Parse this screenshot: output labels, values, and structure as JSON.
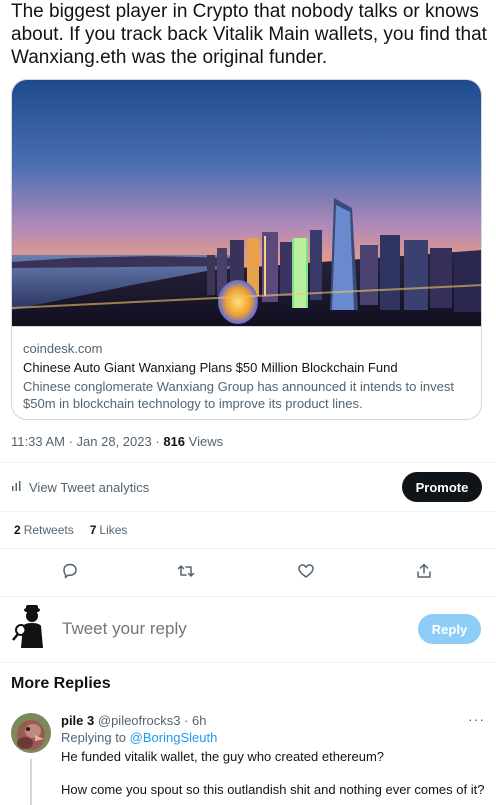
{
  "tweet": {
    "text": "The biggest player in Crypto that nobody talks or knows about. If you track back Vitalik Main wallets, you find that Wanxiang.eth was the original funder."
  },
  "card": {
    "domain": "coindesk.com",
    "title": "Chinese Auto Giant Wanxiang Plans $50 Million Blockchain Fund",
    "description": "Chinese conglomerate Wanxiang Group has announced it intends to invest $50m in blockchain technology to improve its product lines."
  },
  "meta": {
    "time": "11:33 AM",
    "date": "Jan 28, 2023",
    "views_count": "816",
    "views_label": "Views"
  },
  "analytics": {
    "icon": "bar-chart-icon",
    "label": "View Tweet analytics"
  },
  "promote_label": "Promote",
  "stats": {
    "retweets_count": "2",
    "retweets_label": "Retweets",
    "likes_count": "7",
    "likes_label": "Likes"
  },
  "actions": {
    "reply_icon": "reply-icon",
    "retweet_icon": "retweet-icon",
    "like_icon": "heart-icon",
    "share_icon": "share-icon"
  },
  "compose": {
    "placeholder": "Tweet your reply",
    "button": "Reply",
    "button_color": "#8ecdf8"
  },
  "more_replies": {
    "heading": "More Replies"
  },
  "reply": {
    "name": "pile 3",
    "handle": "@pileofrocks3",
    "separator": "·",
    "time": "6h",
    "replying_prefix": "Replying to",
    "replying_handle": "@BoringSleuth",
    "line1": "He funded vitalik wallet, the guy who created ethereum?",
    "line2": "How come you spout so this outlandish shit and nothing ever comes of it?",
    "more_glyph": "···"
  },
  "colors": {
    "text_primary": "#0f1419",
    "text_secondary": "#536471",
    "accent": "#1d9bf0",
    "promote_bg": "#0f1419",
    "border": "#cfd9de"
  }
}
